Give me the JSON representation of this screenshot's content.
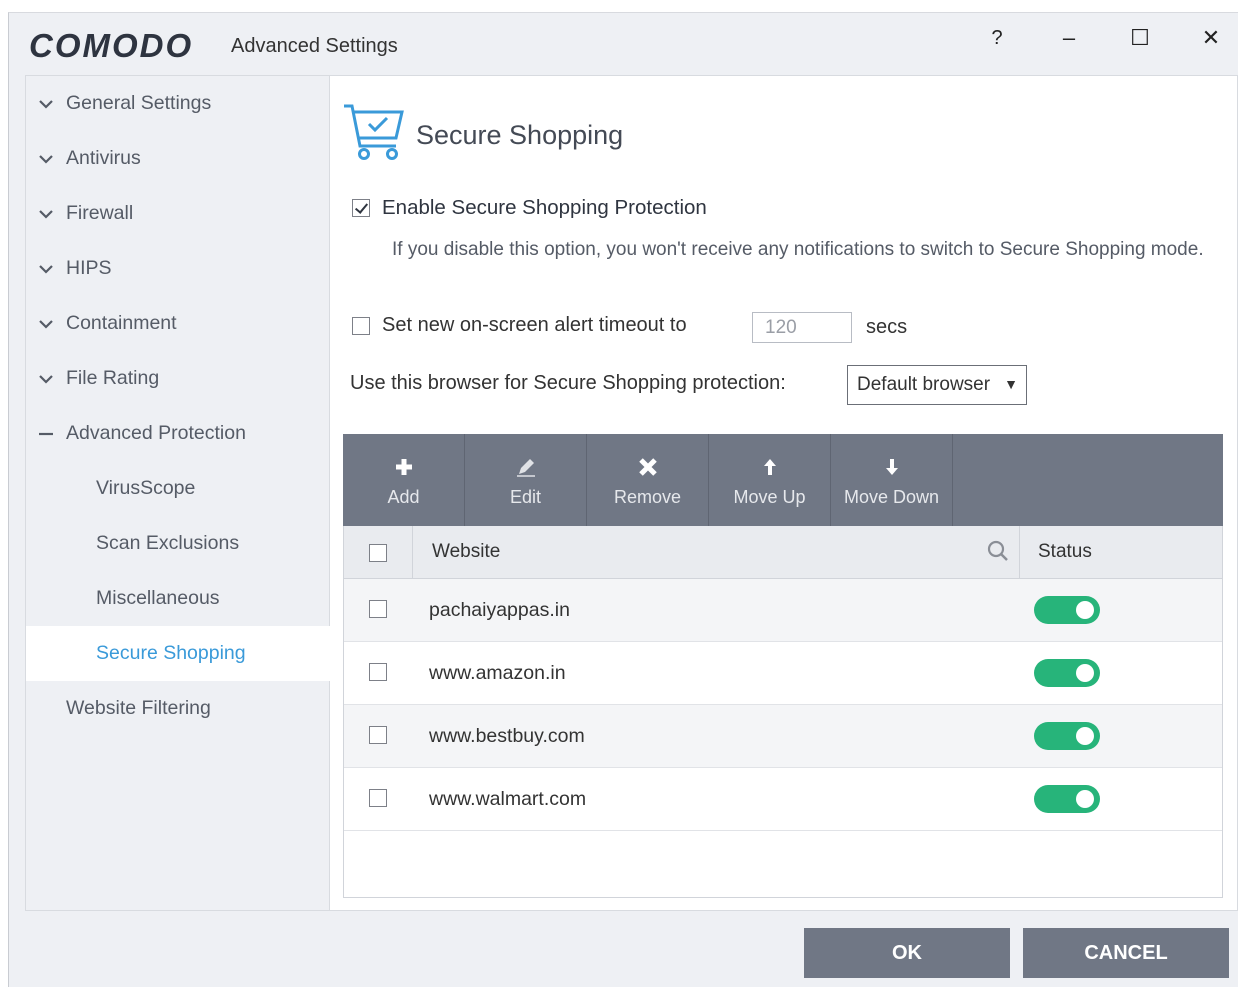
{
  "window": {
    "brand": "COMODO",
    "title": "Advanced Settings",
    "controls": {
      "help": "?",
      "minimize": "–",
      "maximize": "☐",
      "close": "✕"
    }
  },
  "sidebar": {
    "items": [
      {
        "label": "General Settings",
        "icon": "chevron-down-icon"
      },
      {
        "label": "Antivirus",
        "icon": "chevron-down-icon"
      },
      {
        "label": "Firewall",
        "icon": "chevron-down-icon"
      },
      {
        "label": "HIPS",
        "icon": "chevron-down-icon"
      },
      {
        "label": "Containment",
        "icon": "chevron-down-icon"
      },
      {
        "label": "File Rating",
        "icon": "chevron-down-icon"
      },
      {
        "label": "Advanced Protection",
        "icon": "collapse-dash-icon"
      },
      {
        "label": "VirusScope"
      },
      {
        "label": "Scan Exclusions"
      },
      {
        "label": "Miscellaneous"
      },
      {
        "label": "Secure Shopping",
        "active": true
      },
      {
        "label": "Website Filtering"
      }
    ]
  },
  "main": {
    "title": "Secure Shopping",
    "title_icon": "shopping-cart-check-icon",
    "enable_label": "Enable Secure Shopping Protection",
    "enable_checked": true,
    "enable_desc": "If you disable this option, you won't receive any notifications to switch to Secure Shopping mode.",
    "timeout_label": "Set new on-screen alert timeout to",
    "timeout_checked": false,
    "timeout_value": "120",
    "timeout_unit": "secs",
    "browser_label": "Use this browser for Secure Shopping protection:",
    "browser_selected": "Default browser"
  },
  "toolbar": {
    "add": "Add",
    "edit": "Edit",
    "remove": "Remove",
    "move_up": "Move Up",
    "move_down": "Move Down"
  },
  "table": {
    "col_website": "Website",
    "col_status": "Status",
    "rows": [
      {
        "site": "pachaiyappas.in",
        "enabled": true
      },
      {
        "site": "www.amazon.in",
        "enabled": true
      },
      {
        "site": "www.bestbuy.com",
        "enabled": true
      },
      {
        "site": "www.walmart.com",
        "enabled": true
      }
    ]
  },
  "footer": {
    "ok": "OK",
    "cancel": "CANCEL"
  },
  "colors": {
    "accent": "#3a9ad9",
    "toolbar": "#707785",
    "toggle_on": "#27b47a"
  }
}
